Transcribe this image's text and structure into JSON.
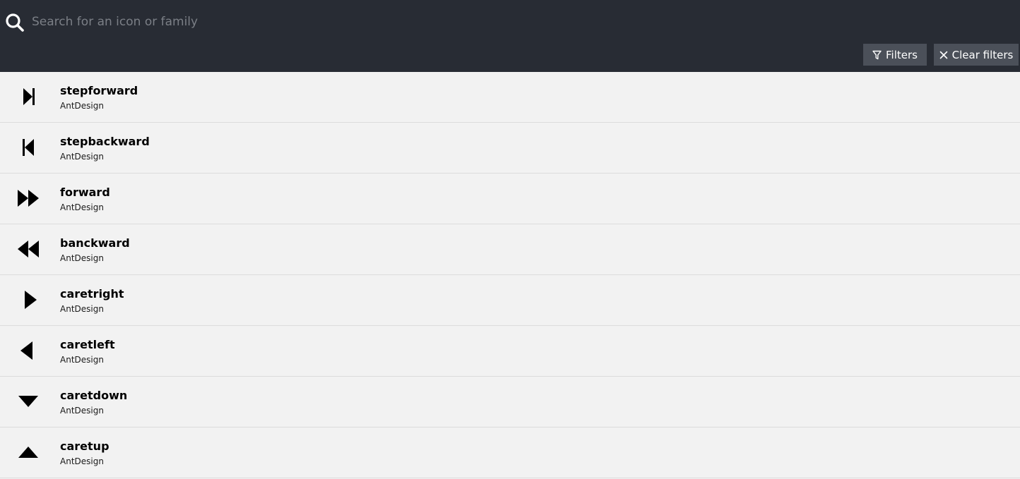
{
  "search": {
    "placeholder": "Search for an icon or family",
    "value": ""
  },
  "toolbar": {
    "filters_label": "Filters",
    "clear_filters_label": "Clear filters"
  },
  "colors": {
    "header_bg": "#282c34",
    "button_bg": "#4b5059",
    "list_bg": "#f2f2f2"
  },
  "icons": [
    {
      "name": "stepforward",
      "family": "AntDesign",
      "glyph": "step-forward-icon"
    },
    {
      "name": "stepbackward",
      "family": "AntDesign",
      "glyph": "step-backward-icon"
    },
    {
      "name": "forward",
      "family": "AntDesign",
      "glyph": "forward-icon"
    },
    {
      "name": "banckward",
      "family": "AntDesign",
      "glyph": "backward-icon"
    },
    {
      "name": "caretright",
      "family": "AntDesign",
      "glyph": "caret-right-icon"
    },
    {
      "name": "caretleft",
      "family": "AntDesign",
      "glyph": "caret-left-icon"
    },
    {
      "name": "caretdown",
      "family": "AntDesign",
      "glyph": "caret-down-icon"
    },
    {
      "name": "caretup",
      "family": "AntDesign",
      "glyph": "caret-up-icon"
    }
  ]
}
